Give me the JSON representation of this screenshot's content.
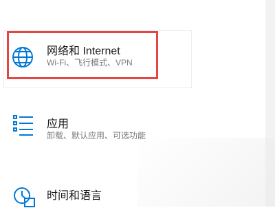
{
  "settings_items": [
    {
      "icon": "globe-icon",
      "title": "网络和 Internet",
      "subtitle": "Wi-Fi、飞行模式、VPN"
    },
    {
      "icon": "apps-list-icon",
      "title": "应用",
      "subtitle": "卸载、默认应用、可选功能"
    },
    {
      "icon": "time-language-icon",
      "title": "时间和语言",
      "subtitle": ""
    }
  ],
  "colors": {
    "accent": "#0078d7",
    "highlight": "#e64545"
  }
}
